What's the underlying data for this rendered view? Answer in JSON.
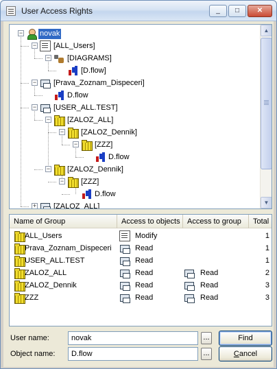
{
  "window": {
    "title": "User Access Rights",
    "minimize_glyph": "_",
    "maximize_glyph": "□",
    "close_glyph": "✕",
    "app_icon": "sheet-icon"
  },
  "tree": {
    "nodes": [
      {
        "label": "novak",
        "icon": "user-icon",
        "selected": true,
        "expander": "−"
      },
      {
        "label": "[ALL_Users]",
        "icon": "sheet-icon",
        "expander": "−"
      },
      {
        "label": "[DIAGRAMS]",
        "icon": "diagrams-icon",
        "expander": "−"
      },
      {
        "label": "[D.flow]",
        "icon": "flow-icon"
      },
      {
        "label": "[Prava_Zoznam_Dispeceri]",
        "icon": "group-icon",
        "expander": "−"
      },
      {
        "label": "D.flow",
        "icon": "flow-icon"
      },
      {
        "label": "[USER_ALL.TEST]",
        "icon": "group-icon",
        "expander": "−"
      },
      {
        "label": "[ZALOZ_ALL]",
        "icon": "folder-icon",
        "expander": "−"
      },
      {
        "label": "[ZALOZ_Dennik]",
        "icon": "folder-icon",
        "expander": "−"
      },
      {
        "label": "[ZZZ]",
        "icon": "folder-icon",
        "expander": "−"
      },
      {
        "label": "D.flow",
        "icon": "flow-icon"
      },
      {
        "label": "[ZALOZ_Dennik]",
        "icon": "folder-icon",
        "expander": "−"
      },
      {
        "label": "[ZZZ]",
        "icon": "folder-icon",
        "expander": "−"
      },
      {
        "label": "D.flow",
        "icon": "flow-icon"
      },
      {
        "label": "[ZALOZ_ALL]",
        "icon": "group-icon",
        "expander": "+"
      }
    ]
  },
  "list": {
    "columns": [
      "Name of Group",
      "Access to objects",
      "Access to group",
      "Total"
    ],
    "rows": [
      {
        "name": "ALL_Users",
        "access_objects": "Modify",
        "access_objects_icon": "sheet-icon",
        "access_group": "",
        "total": "1"
      },
      {
        "name": "Prava_Zoznam_Dispeceri",
        "access_objects": "Read",
        "access_objects_icon": "group-icon",
        "access_group": "",
        "total": "1"
      },
      {
        "name": "USER_ALL.TEST",
        "access_objects": "Read",
        "access_objects_icon": "group-icon",
        "access_group": "",
        "total": "1"
      },
      {
        "name": "ZALOZ_ALL",
        "access_objects": "Read",
        "access_objects_icon": "group-icon",
        "access_group": "Read",
        "total": "2"
      },
      {
        "name": "ZALOZ_Dennik",
        "access_objects": "Read",
        "access_objects_icon": "group-icon",
        "access_group": "Read",
        "total": "3"
      },
      {
        "name": "ZZZ",
        "access_objects": "Read",
        "access_objects_icon": "group-icon",
        "access_group": "Read",
        "total": "3"
      }
    ]
  },
  "form": {
    "user_name_label": "User name:",
    "user_name_value": "novak",
    "object_name_label": "Object name:",
    "object_name_value": "D.flow",
    "browse_label": "...",
    "find_label": "Find",
    "cancel_first": "C",
    "cancel_rest": "ancel"
  },
  "colors": {
    "selection": "#316ac5",
    "border": "#7f9db9",
    "dialog_bg": "#ece9d8"
  }
}
